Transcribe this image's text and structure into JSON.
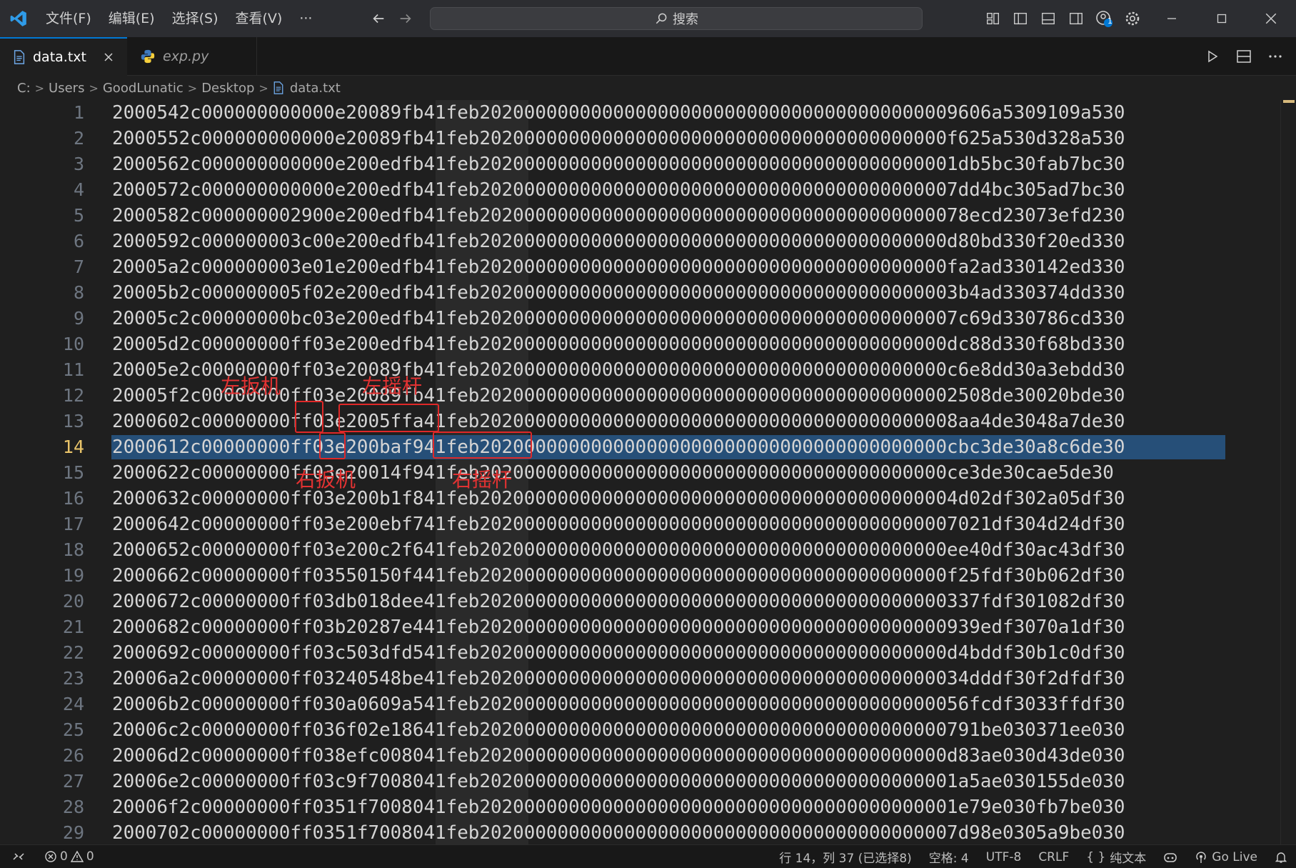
{
  "titlebar": {
    "menu": [
      "文件(F)",
      "编辑(E)",
      "选择(S)",
      "查看(V)",
      "···"
    ],
    "search_placeholder": "搜索",
    "notification_badge": "1"
  },
  "tabs": [
    {
      "label": "data.txt",
      "active": true
    },
    {
      "label": "exp.py",
      "active": false
    }
  ],
  "breadcrumb": [
    "C:",
    "Users",
    "GoodLunatic",
    "Desktop",
    "data.txt"
  ],
  "editor": {
    "current_line": 14,
    "lines": [
      "2000542c000000000000e20089fb41feb2020000000000000000000000000000000000000009606a5309109a530",
      "2000552c000000000000e20089fb41feb202000000000000000000000000000000000000000f625a530d328a530",
      "2000562c000000000000e200edfb41feb2020000000000000000000000000000000000000001db5bc30fab7bc30",
      "2000572c000000000000e200edfb41feb2020000000000000000000000000000000000000007dd4bc305ad7bc30",
      "2000582c000000002900e200edfb41feb20200000000000000000000000000000000000000078ecd23073efd230",
      "2000592c000000003c00e200edfb41feb202000000000000000000000000000000000000000d80bd330f20ed330",
      "20005a2c000000003e01e200edfb41feb202000000000000000000000000000000000000000fa2ad330142ed330",
      "20005b2c000000005f02e200edfb41feb2020000000000000000000000000000000000000003b4ad330374dd330",
      "20005c2c00000000bc03e200edfb41feb2020000000000000000000000000000000000000007c69d330786cd330",
      "20005d2c00000000ff03e200edfb41feb202000000000000000000000000000000000000000dc88d330f68bd330",
      "20005e2c00000000ff03e20089fb41feb202000000000000000000000000000000000000000c6e8dd30a3ebdd30",
      "20005f2c00000000ff03e20089fb41feb2020000000000000000000000000000000000000002508de30020bde30",
      "2000602c00000000ff03e2005ffa41feb2020000000000000000000000000000000000000008aa4de3048a7de30",
      "2000612c00000000ff03e200baf941feb202000000000000000000000000000000000000000cbc3de30a8c6de30",
      "2000622c00000000ff03e20014f941feb202000000000000000000000000000000000000000ce3de30cae5de30",
      "2000632c00000000ff03e200b1f841feb2020000000000000000000000000000000000000004d02df302a05df30",
      "2000642c00000000ff03e200ebf741feb2020000000000000000000000000000000000000007021df304d24df30",
      "2000652c00000000ff03e200c2f641feb202000000000000000000000000000000000000000ee40df30ac43df30",
      "2000662c00000000ff03550150f441feb202000000000000000000000000000000000000000f25fdf30b062df30",
      "2000672c00000000ff03db018dee41feb202000000000000000000000000000000000000000337fdf301082df30",
      "2000682c00000000ff03b20287e441feb202000000000000000000000000000000000000000939edf3070a1df30",
      "2000692c00000000ff03c503dfd541feb202000000000000000000000000000000000000000d4bddf30b1c0df30",
      "20006a2c00000000ff03240548be41feb20200000000000000000000000000000000000000034dddf30f2dfdf30",
      "20006b2c00000000ff030a0609a541feb20200000000000000000000000000000000000000056fcdf3033ffdf30",
      "20006c2c00000000ff036f02e18641feb202000000000000000000000000000000000000000791be030371ee030",
      "20006d2c00000000ff038efc008041feb202000000000000000000000000000000000000000d83ae030d43de030",
      "20006e2c00000000ff03c9f7008041feb2020000000000000000000000000000000000000001a5ae030155de030",
      "20006f2c00000000ff0351f7008041feb2020000000000000000000000000000000000000001e79e030fb7be030",
      "2000702c00000000ff0351f7008041feb2020000000000000000000000000000000000000007d98e0305a9be030"
    ]
  },
  "annotations": {
    "left_trigger": "左扳机",
    "left_stick": "左摇杆",
    "right_trigger": "右扳机",
    "right_stick": "右摇杆"
  },
  "statusbar": {
    "errors": "0",
    "warnings": "0",
    "position": "行 14，列 37 (已选择8)",
    "spaces": "空格: 4",
    "encoding": "UTF-8",
    "eol": "CRLF",
    "language": "纯文本",
    "golive": "Go Live"
  },
  "colors": {
    "accent": "#0078d4",
    "selection": "#264f78",
    "annotation": "#e02828",
    "current_line_number": "#e9c46a"
  }
}
